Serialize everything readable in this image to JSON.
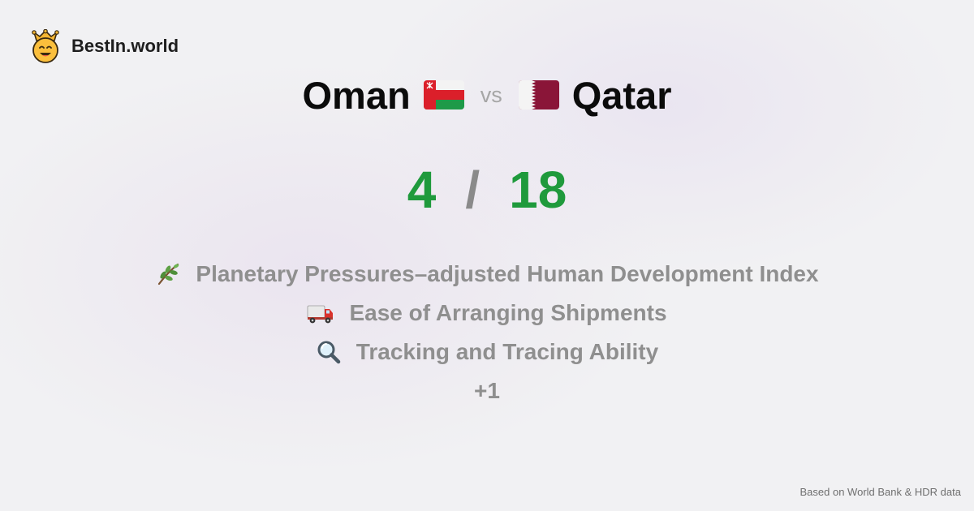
{
  "brand": {
    "name": "BestIn.world",
    "logo_icon": "crown-smiley-icon"
  },
  "comparison": {
    "left_country": "Oman",
    "vs_label": "vs",
    "right_country": "Qatar",
    "left_flag_icon": "oman-flag-icon",
    "right_flag_icon": "qatar-flag-icon"
  },
  "score": {
    "left": "4",
    "separator": "/",
    "right": "18",
    "color": "#1f9a3c"
  },
  "metrics": [
    {
      "icon": "herb-branch-icon",
      "label": "Planetary Pressures–adjusted Human Development Index"
    },
    {
      "icon": "delivery-truck-icon",
      "label": "Ease of Arranging Shipments"
    },
    {
      "icon": "magnifying-glass-icon",
      "label": "Tracking and Tracing Ability"
    }
  ],
  "more_label": "+1",
  "footer": {
    "source": "Based on World Bank & HDR data"
  }
}
